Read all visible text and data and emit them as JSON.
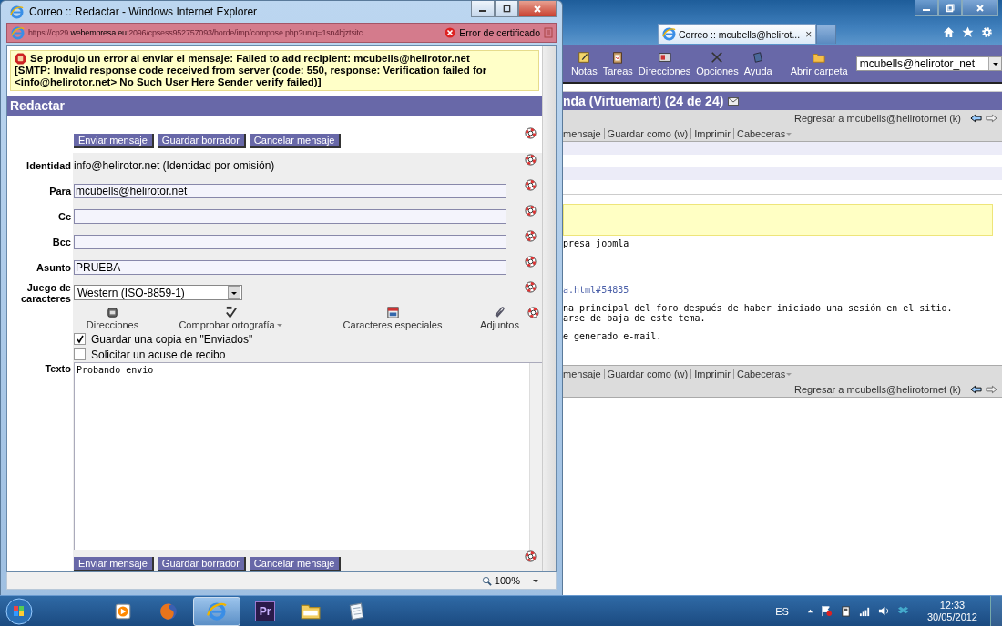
{
  "browser": {
    "tab": {
      "title": "Correo :: mcubells@helirot...",
      "close": "×"
    },
    "toolbar": [
      {
        "kind": "notes",
        "label": "Notas"
      },
      {
        "kind": "tasks",
        "label": "Tareas"
      },
      {
        "kind": "contacts",
        "label": "Direcciones"
      },
      {
        "kind": "options",
        "label": "Opciones"
      },
      {
        "kind": "help",
        "label": "Ayuda"
      },
      {
        "kind": "folder",
        "label": "Abrir carpeta"
      }
    ],
    "account_select": {
      "value": "mcubells@helirotor_net"
    },
    "message_title": "nda (Virtuemart) (24 de 24)",
    "back_link": "Regresar a mcubells@helirotornet (k)",
    "actions": [
      "mensaje",
      "Guardar como (w)",
      "Imprimir",
      "Cabeceras"
    ],
    "body": [
      {
        "kind": "text",
        "lines": [
          "presa joomla"
        ]
      },
      {
        "kind": "link",
        "lines": [
          "a.html#54835"
        ]
      },
      {
        "kind": "text",
        "lines": [
          "na principal del foro después de haber iniciado una sesión en el sitio.",
          "arse de baja de este tema."
        ]
      },
      {
        "kind": "text",
        "lines": [
          "e generado e-mail."
        ]
      }
    ],
    "bottom_actions": [
      "mensaje",
      "Guardar como (w)",
      "Imprimir",
      "Cabeceras"
    ],
    "bottom_back_link": "Regresar a mcubells@helirotornet (k)"
  },
  "popup": {
    "title": "Correo :: Redactar - Windows Internet Explorer",
    "address": {
      "prefix": "https://cp29.",
      "domain": "webempresa.eu",
      "rest": ":2096/cpsess952757093/horde/imp/compose.php?uniq=1sn4bjztsitc"
    },
    "cert_error": "Error de certificado",
    "error": {
      "message": "Se produjo un error al enviar el mensaje: Failed to add recipient: mcubells@helirotor.net",
      "details": "[SMTP: Invalid response code received from server (code: 550, response: Verification failed for <info@helirotor.net> No Such User Here Sender verify failed)]"
    },
    "heading": "Redactar",
    "buttons": [
      "Enviar mensaje",
      "Guardar borrador",
      "Cancelar mensaje"
    ],
    "fields": [
      {
        "kind": "text",
        "label": "Identidad",
        "value": "info@helirotor.net (Identidad por omisión)"
      },
      {
        "kind": "input",
        "label": "Para",
        "value": "mcubells@helirotor.net"
      },
      {
        "kind": "input",
        "label": "Cc"
      },
      {
        "kind": "input",
        "label": "Bcc"
      },
      {
        "kind": "input",
        "label": "Asunto",
        "value": "PRUEBA"
      },
      {
        "kind": "select",
        "label": "Juego de caracteres",
        "value": "Western (ISO-8859-1)"
      }
    ],
    "tools": [
      {
        "kind": "contacts",
        "label": "Direcciones",
        "menu": false
      },
      {
        "kind": "spell",
        "label": "Comprobar ortografía",
        "menu": true
      },
      {
        "kind": "chars",
        "label": "Caracteres especiales",
        "menu": false
      },
      {
        "kind": "attach",
        "label": "Adjuntos",
        "menu": false
      }
    ],
    "options": [
      {
        "label": "Guardar una copia en \"Enviados\"",
        "checked": true
      },
      {
        "label": "Solicitar un acuse de recibo",
        "checked": false
      }
    ],
    "message": {
      "label": "Texto",
      "value": "Probando envio"
    },
    "bottom_buttons": [
      "Enviar mensaje",
      "Guardar borrador",
      "Cancelar mensaje"
    ],
    "zoom": "100%"
  },
  "taskbar": {
    "apps": [
      {
        "kind": "media",
        "selected": false
      },
      {
        "kind": "firefox",
        "selected": false
      },
      {
        "kind": "ie",
        "selected": true
      },
      {
        "kind": "premiere",
        "label": "Pr",
        "selected": false
      },
      {
        "kind": "folder",
        "selected": false
      },
      {
        "kind": "notepad",
        "selected": false
      }
    ],
    "language": "ES",
    "time": "12:33",
    "date": "30/05/2012"
  }
}
